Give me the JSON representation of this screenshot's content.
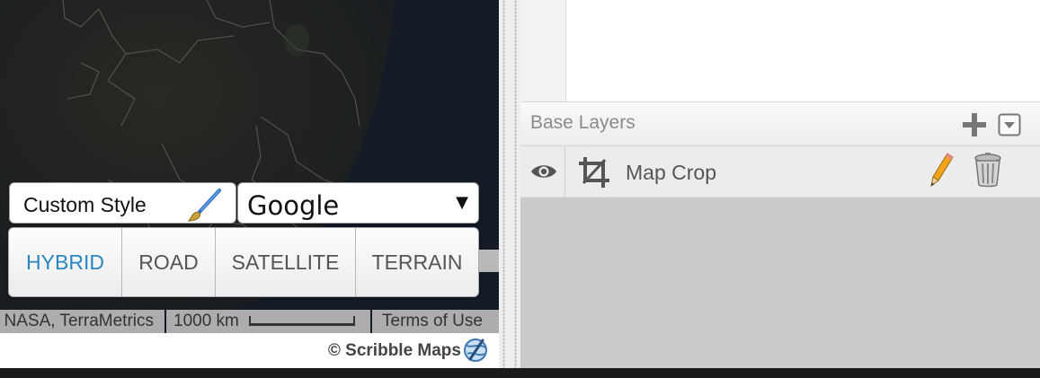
{
  "map": {
    "custom_style_label": "Custom Style",
    "provider_selected": "Google",
    "map_types": [
      {
        "label": "HYBRID",
        "active": true
      },
      {
        "label": "ROAD",
        "active": false
      },
      {
        "label": "SATELLITE",
        "active": false
      },
      {
        "label": "TERRAIN",
        "active": false
      }
    ],
    "attribution": "NASA, TerraMetrics",
    "scale_label": "1000 km",
    "terms_label": "Terms of Use",
    "brand": "© Scribble Maps"
  },
  "panel": {
    "base_layers_title": "Base Layers",
    "layers": [
      {
        "name": "Map Crop",
        "visible": true
      }
    ]
  },
  "colors": {
    "active_tab": "#2a86c1",
    "panel_bg": "#cacaca",
    "map_bg": "#151922"
  },
  "icons": [
    "paintbrush-icon",
    "dropdown-caret-icon",
    "scribble-globe-icon",
    "plus-icon",
    "collapse-icon",
    "eye-icon",
    "crop-icon",
    "pencil-icon",
    "trash-icon"
  ]
}
